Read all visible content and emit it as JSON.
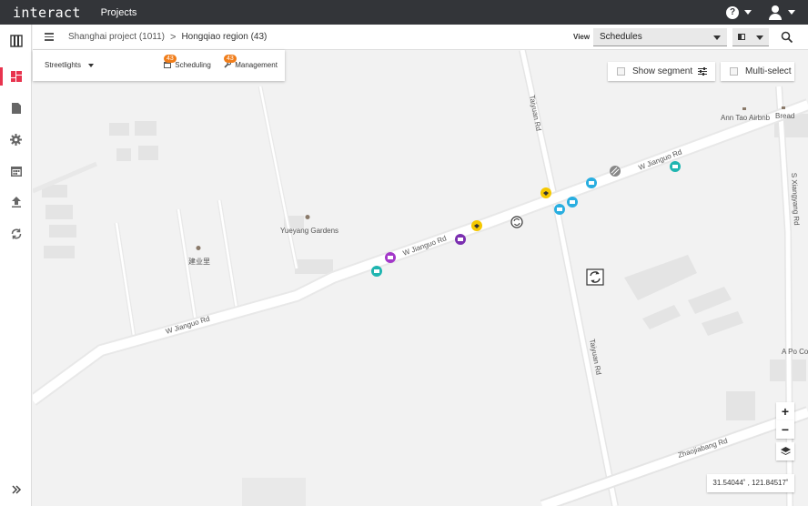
{
  "app": {
    "logo": "interact",
    "projects_link": "Projects"
  },
  "breadcrumb": {
    "project": "Shanghai project (1011)",
    "separator": ">",
    "region": "Hongqiao region (43)"
  },
  "view": {
    "label": "View",
    "selected": "Schedules"
  },
  "panel": {
    "asset_type": "Streetlights",
    "tabs": [
      {
        "label": "Scheduling",
        "badge": "43",
        "icon": "calendar-icon"
      },
      {
        "label": "Management",
        "badge": "43",
        "icon": "wrench-icon"
      }
    ]
  },
  "map_controls": {
    "show_segment": "Show segment",
    "multi_select": "Multi-select",
    "zoom_in": "+",
    "zoom_out": "−",
    "coordinates": "31.54044˚ , 121.84517˚"
  },
  "map_labels": {
    "jianguo_1": "W Jianguo Rd",
    "jianguo_2": "W Jianguo Rd",
    "jianguo_3": "W Jianguo Rd",
    "taiyuan_1": "Taiyuan Rd",
    "taiyuan_2": "Taiyuan Rd",
    "xiangyang": "S Xiangyang Rd",
    "zhaojiabang": "Zhaojiabang Rd",
    "yueyang": "Yueyang Gardens",
    "jianyeli": "建业里",
    "antao": "Ann Tao Airbnb",
    "bread": "Bread",
    "apo": "A Po Co"
  },
  "colors": {
    "topbar": "#333539",
    "accent_red": "#e8344e",
    "badge_orange": "#f07d1a",
    "marker_teal": "#1fb5b0",
    "marker_cyan": "#29aee0",
    "marker_purple": "#7b2fb0",
    "marker_violet": "#a338c9",
    "marker_yellow": "#f5c800"
  }
}
